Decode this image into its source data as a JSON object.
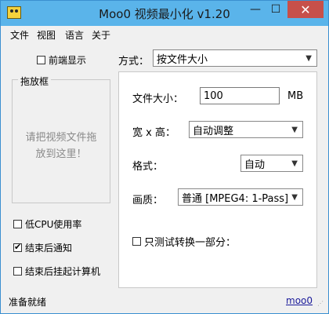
{
  "window": {
    "title": "Moo0 视频最小化 v1.20",
    "min_label": "—",
    "max_label": "☐",
    "close_label": "✕"
  },
  "menu": [
    "文件",
    "视图",
    "语言",
    "关于"
  ],
  "left": {
    "always_front": {
      "label": "前端显示",
      "checked": false
    },
    "dropbox": {
      "title": "拖放框",
      "hint_line1": "请把视频文件拖",
      "hint_line2": "放到这里！"
    },
    "options": [
      {
        "label": "低CPU使用率",
        "checked": false
      },
      {
        "label": "结束后通知",
        "checked": true
      },
      {
        "label": "结束后挂起计算机",
        "checked": false
      }
    ]
  },
  "method": {
    "label": "方式：",
    "value": "按文件大小"
  },
  "panel": {
    "filesize": {
      "label": "文件大小：",
      "value": "100",
      "unit": "MB"
    },
    "dimensions": {
      "label": "宽 x 高：",
      "value": "自动调整"
    },
    "format": {
      "label": "格式：",
      "value": "自动"
    },
    "quality": {
      "label": "画质：",
      "value": "普通  [MPEG4: 1-Pass]"
    },
    "partial": {
      "label": "只测试转换一部分：",
      "checked": false
    }
  },
  "status": {
    "text": "准备就绪",
    "link": "moo0"
  }
}
